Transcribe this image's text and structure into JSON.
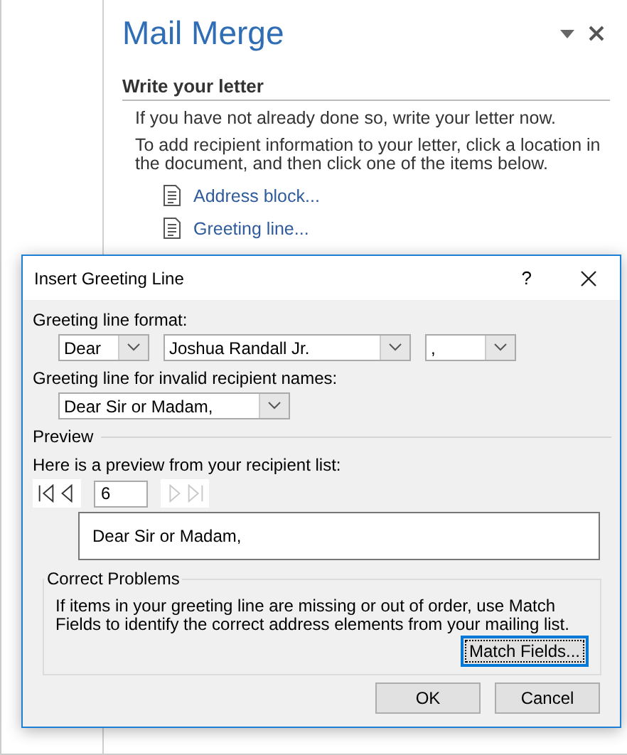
{
  "task_pane": {
    "title": "Mail Merge",
    "section_title": "Write your letter",
    "paragraphs": [
      "If you have not already done so, write your letter now.",
      "To add recipient information to your letter, click a location in the document, and then click one of the items below."
    ],
    "links": [
      {
        "label": "Address block..."
      },
      {
        "label": "Greeting line..."
      }
    ]
  },
  "dialog": {
    "title": "Insert Greeting Line",
    "help": "?",
    "greeting_format": {
      "label": "Greeting line format:",
      "salutation": "Dear",
      "name_format": "Joshua Randall Jr.",
      "punctuation": ","
    },
    "invalid_names": {
      "label": "Greeting line for invalid recipient names:",
      "value": "Dear Sir or Madam,"
    },
    "preview": {
      "heading": "Preview",
      "label": "Here is a preview from your recipient list:",
      "record": "6",
      "text": "Dear Sir or Madam,",
      "nav_buttons": [
        {
          "kind": "first",
          "disabled": false
        },
        {
          "kind": "prev",
          "disabled": false
        },
        {
          "kind": "next",
          "disabled": true
        },
        {
          "kind": "last",
          "disabled": true
        }
      ]
    },
    "correct_problems": {
      "heading": "Correct Problems",
      "text": "If items in your greeting line are missing or out of order, use Match Fields to identify the correct address elements from your mailing list.",
      "button": {
        "label": "Match Fields...",
        "focused": true
      }
    },
    "buttons": [
      "OK",
      "Cancel"
    ]
  }
}
